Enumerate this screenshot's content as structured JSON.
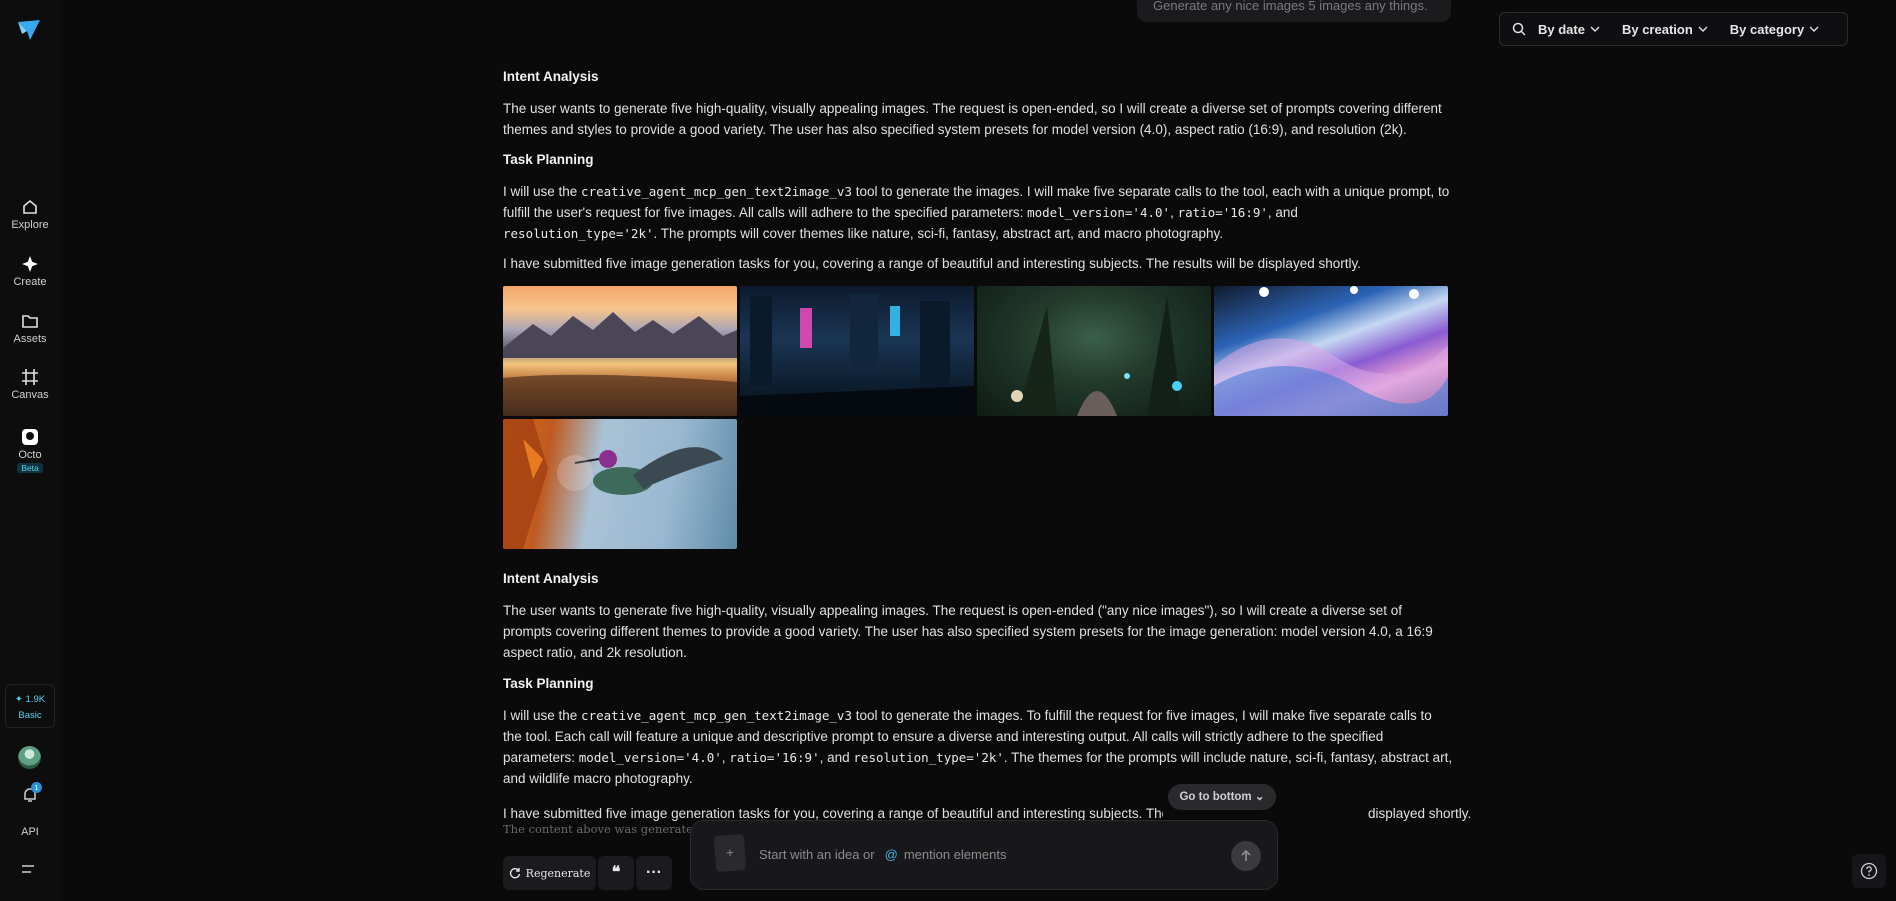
{
  "top_bubble_text": "Generate any nice images 5 images any things.",
  "sidebar": {
    "items": [
      {
        "label": "Explore"
      },
      {
        "label": "Create"
      },
      {
        "label": "Assets"
      },
      {
        "label": "Canvas"
      },
      {
        "label": "Octo",
        "badge": "Beta"
      }
    ],
    "credits": {
      "amount": "1.9K",
      "plan": "Basic"
    },
    "notification_count": "1",
    "api_label": "API"
  },
  "filters": {
    "by_date": "By date",
    "by_creation": "By creation",
    "by_category": "By category"
  },
  "messages": [
    {
      "intent_heading": "Intent Analysis",
      "intent_text": "The user wants to generate five high-quality, visually appealing images. The request is open-ended, so I will create a diverse set of prompts covering different themes and styles to provide a good variety. The user has also specified system presets for model version (4.0), aspect ratio (16:9), and resolution (2k).",
      "planning_heading": "Task Planning",
      "plan_a": "I will use the ",
      "tool": "creative_agent_mcp_gen_text2image_v3",
      "plan_b": " tool to generate the images. I will make five separate calls to the tool, each with a unique prompt, to fulfill the user's request for five images. All calls will adhere to the specified parameters: ",
      "p1": "model_version='4.0'",
      "p2": "ratio='16:9'",
      "p3": "resolution_type='2k'",
      "plan_c": ". The prompts will cover themes like nature, sci-fi, fantasy, abstract art, and macro photography.",
      "result": "I have submitted five image generation tasks for you, covering a range of beautiful and interesting subjects. The results will be displayed shortly."
    },
    {
      "intent_heading": "Intent Analysis",
      "intent_text": "The user wants to generate five high-quality, visually appealing images. The request is open-ended (\"any nice images\"), so I will create a diverse set of prompts covering different themes to provide a good variety. The user has also specified system presets for the image generation: model version 4.0, a 16:9 aspect ratio, and 2k resolution.",
      "planning_heading": "Task Planning",
      "plan_a": "I will use the ",
      "tool": "creative_agent_mcp_gen_text2image_v3",
      "plan_b": " tool to generate the images. To fulfill the request for five images, I will make five separate calls to the tool. Each call will feature a unique and descriptive prompt to ensure a diverse and interesting output. All calls will strictly adhere to the specified parameters: ",
      "p1": "model_version='4.0'",
      "p2": "ratio='16:9'",
      "p3": "resolution_type='2k'",
      "plan_c": ". The themes for the prompts will include nature, sci-fi, fantasy, abstract art, and wildlife macro photography.",
      "result_visible_start": "I have submitted five image generation tasks for you, covering a range of beautiful and interesting subjects. The",
      "result_visible_end": "displayed shortly."
    }
  ],
  "footnote": "The content above was generated by",
  "actions": {
    "regenerate": "Regenerate",
    "quote": "❝",
    "more": "···"
  },
  "go_to_bottom": "Go to bottom",
  "composer": {
    "placeholder_a": "Start with an idea or",
    "at": "@",
    "placeholder_b": "mention elements"
  }
}
